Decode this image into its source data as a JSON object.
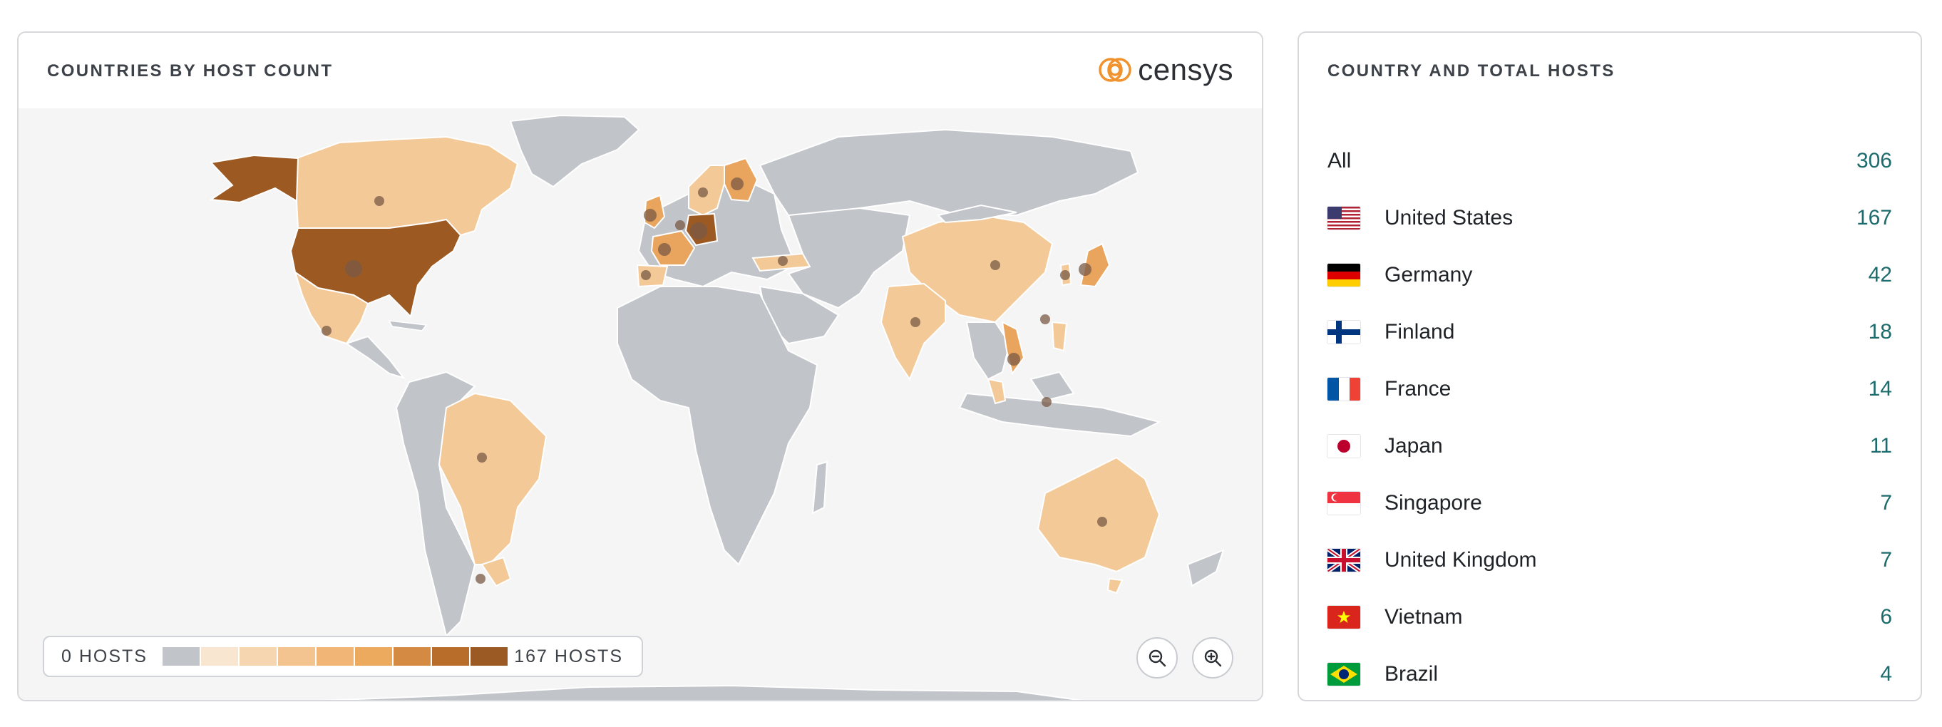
{
  "map_panel": {
    "title": "COUNTRIES BY HOST COUNT",
    "logo_text": "censys",
    "legend": {
      "min_label": "0 HOSTS",
      "max_label": "167 HOSTS",
      "scale_colors": [
        "#c1c4c9",
        "#f9e6d1",
        "#f6d6b0",
        "#f3c48f",
        "#f1b676",
        "#ecaa5e",
        "#d58a44",
        "#b96d2a",
        "#9b5a23"
      ]
    },
    "zoom_out_icon": "zoom-out-icon",
    "zoom_in_icon": "zoom-in-icon",
    "colors": {
      "no_hosts": "#c1c4c9",
      "low": "#f4c998",
      "mid": "#e9a45e",
      "high": "#9c5a22",
      "marker": "#7a5a45",
      "ocean": "#f4f5f4"
    }
  },
  "list_panel": {
    "title": "COUNTRY AND TOTAL HOSTS",
    "rows": [
      {
        "name": "All",
        "count": "306",
        "flag": ""
      },
      {
        "name": "United States",
        "count": "167",
        "flag": "us-flag-icon"
      },
      {
        "name": "Germany",
        "count": "42",
        "flag": "de-flag-icon"
      },
      {
        "name": "Finland",
        "count": "18",
        "flag": "fi-flag-icon"
      },
      {
        "name": "France",
        "count": "14",
        "flag": "fr-flag-icon"
      },
      {
        "name": "Japan",
        "count": "11",
        "flag": "jp-flag-icon"
      },
      {
        "name": "Singapore",
        "count": "7",
        "flag": "sg-flag-icon"
      },
      {
        "name": "United Kingdom",
        "count": "7",
        "flag": "gb-flag-icon"
      },
      {
        "name": "Vietnam",
        "count": "6",
        "flag": "vn-flag-icon"
      },
      {
        "name": "Brazil",
        "count": "4",
        "flag": "br-flag-icon"
      }
    ]
  }
}
